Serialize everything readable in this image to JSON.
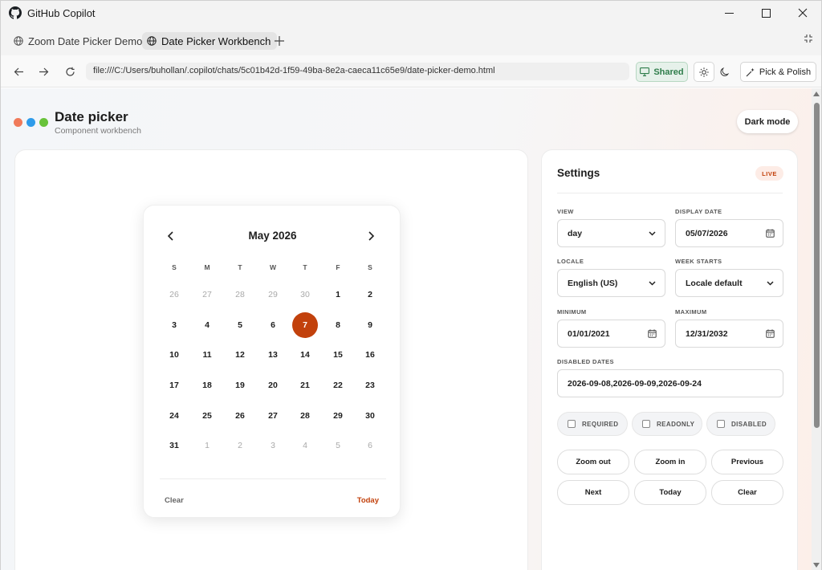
{
  "window": {
    "title": "GitHub Copilot"
  },
  "tabs": [
    {
      "label": "Zoom Date Picker Demo"
    },
    {
      "label": "Date Picker Workbench"
    }
  ],
  "address": {
    "url": "file:///C:/Users/buhollan/.copilot/chats/5c01b42d-1f59-49ba-8e2a-caeca11c65e9/date-picker-demo.html",
    "shared_label": "Shared",
    "pick_label": "Pick & Polish"
  },
  "header": {
    "title": "Date picker",
    "subtitle": "Component workbench",
    "dark_mode_label": "Dark mode",
    "dot_colors": [
      "#f07a5a",
      "#2f9bea",
      "#67c23a"
    ]
  },
  "calendar": {
    "month_label": "May 2026",
    "weekdays": [
      "S",
      "M",
      "T",
      "W",
      "T",
      "F",
      "S"
    ],
    "weeks": [
      [
        "26",
        "27",
        "28",
        "29",
        "30",
        "1",
        "2"
      ],
      [
        "3",
        "4",
        "5",
        "6",
        "7",
        "8",
        "9"
      ],
      [
        "10",
        "11",
        "12",
        "13",
        "14",
        "15",
        "16"
      ],
      [
        "17",
        "18",
        "19",
        "20",
        "21",
        "22",
        "23"
      ],
      [
        "24",
        "25",
        "26",
        "27",
        "28",
        "29",
        "30"
      ],
      [
        "31",
        "1",
        "2",
        "3",
        "4",
        "5",
        "6"
      ]
    ],
    "selected_day": "7",
    "clear_label": "Clear",
    "today_label": "Today",
    "accent": "#c2410c"
  },
  "settings": {
    "title": "Settings",
    "badge": "LIVE",
    "view": {
      "label": "VIEW",
      "value": "day"
    },
    "display_date": {
      "label": "DISPLAY DATE",
      "value": "05/07/2026"
    },
    "locale": {
      "label": "LOCALE",
      "value": "English (US)"
    },
    "week_starts": {
      "label": "WEEK STARTS",
      "value": "Locale default"
    },
    "minimum": {
      "label": "MINIMUM",
      "value": "01/01/2021"
    },
    "maximum": {
      "label": "MAXIMUM",
      "value": "12/31/2032"
    },
    "disabled_dates": {
      "label": "DISABLED DATES",
      "value": "2026-09-08,2026-09-09,2026-09-24"
    },
    "checkboxes": [
      "REQUIRED",
      "READONLY",
      "DISABLED"
    ],
    "buttons": [
      "Zoom out",
      "Zoom in",
      "Previous",
      "Next",
      "Today",
      "Clear"
    ]
  }
}
